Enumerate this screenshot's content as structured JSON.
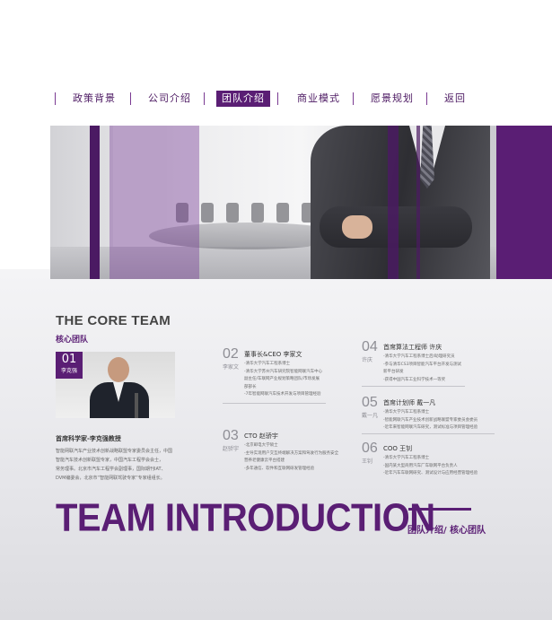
{
  "colors": {
    "accent": "#5a1e74",
    "text": "#333333",
    "muted": "#8e8e95"
  },
  "nav": {
    "items": [
      {
        "label": "政策背景",
        "active": false
      },
      {
        "label": "公司介绍",
        "active": false
      },
      {
        "label": "团队介绍",
        "active": true
      },
      {
        "label": "商业模式",
        "active": false
      },
      {
        "label": "愿景规划",
        "active": false
      },
      {
        "label": "返回",
        "active": false
      }
    ]
  },
  "core": {
    "title": "THE CORE TEAM",
    "subtitle": "核心团队",
    "chief": {
      "number": "01",
      "name": "李克强",
      "title": "首席科学家-李克强教授",
      "lines": [
        "智能网联汽车产业技术创新战略联盟专家委员会主任，中国",
        "智能汽车技术创新联盟专家，中国汽车工程学会会士，",
        "常务理事。北京市汽车工程学会副理事，国际期刊IAT、",
        "DVM编委会，北京市“智能网联驾驶专家”专家组组长。"
      ]
    }
  },
  "members": [
    {
      "number": "02",
      "name": "李家文",
      "role": "董事长&CEO 李家文",
      "lines": [
        "-清华大学汽车工程系博士",
        "-清华大学苏州汽车研究院智能网联汽车中心",
        "副主任/车联网产业规划策略团队/市场发展",
        "部部长",
        "-7年智能网联汽车技术开发与项目管理经验"
      ]
    },
    {
      "number": "03",
      "name": "赵骄宇",
      "role": "CTO 赵骄宇",
      "lines": [
        "-北京邮电大学硕士",
        "-主导实现用户交互终端解决方案和驾驶行为服务安全",
        "营养老健康云平台搭建",
        "-多年通信、软件和互联网研发管理经验"
      ]
    },
    {
      "number": "04",
      "name": "许庆",
      "role": "首席算法工程师 许庆",
      "lines": [
        "-清华大学汽车工程系博士后/助理研究员",
        "-参与清华CS3项目智能汽车平台开发与测试",
        "新平台研发",
        "-获得中国汽车工业科学技术一等奖"
      ]
    },
    {
      "number": "05",
      "name": "戴一凡",
      "role": "首席计划师 戴一凡",
      "lines": [
        "-清华大学汽车工程系博士",
        "-智能网联汽车产业技术创新战略联盟专家委员会委员",
        "-近年来智能网联汽车研究，测试标准与项目管理经验"
      ]
    },
    {
      "number": "06",
      "name": "王钊",
      "role": "COO 王钊",
      "lines": [
        "-清华大学汽车工程系博士",
        "-国内某大型商用汽车厂车联网平台负责人",
        "-近年汽车车联网研究、测试设计与应用经营管理经验"
      ]
    }
  ],
  "footer": {
    "headline": "TEAM INTRODUCTION",
    "label": "团队介绍/ 核心团队"
  }
}
